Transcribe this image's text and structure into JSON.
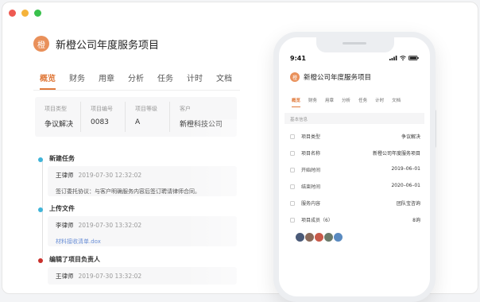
{
  "window": {
    "dots": [
      "#ee5a52",
      "#f5b33b",
      "#39c14c"
    ]
  },
  "project": {
    "avatar_char": "橙",
    "avatar_color": "#e9905a",
    "title": "新橙公司年度服务项目"
  },
  "accent": "#e07a3c",
  "tabs": [
    {
      "label": "概览",
      "active": true
    },
    {
      "label": "财务",
      "active": false
    },
    {
      "label": "用章",
      "active": false
    },
    {
      "label": "分析",
      "active": false
    },
    {
      "label": "任务",
      "active": false
    },
    {
      "label": "计时",
      "active": false
    },
    {
      "label": "文档",
      "active": false
    }
  ],
  "info": [
    {
      "label": "项目类型",
      "value": "争议解决"
    },
    {
      "label": "项目编号",
      "value": "0083"
    },
    {
      "label": "项目等级",
      "value": "A"
    },
    {
      "label": "客户",
      "value": "新橙科技公司"
    }
  ],
  "timeline": [
    {
      "title": "新建任务",
      "color": "#3fb4d8",
      "user": "王律师",
      "time": "2019-07-30 12:32:02",
      "body": "签订委托协议：与客户明确服务内容后签订聘请律师合同。",
      "is_link": false
    },
    {
      "title": "上传文件",
      "color": "#3fb4d8",
      "user": "李律师",
      "time": "2019-07-30 13:32:02",
      "body": "材料接收清单.dox",
      "is_link": true
    },
    {
      "title": "编辑了项目负责人",
      "color": "#c9302c",
      "user": "王律师",
      "time": "2019-07-30 13:32:02",
      "body": "",
      "is_link": false
    }
  ],
  "phone": {
    "time": "9:41",
    "title": "新橙公司年度服务项目",
    "tabs": [
      "概览",
      "财务",
      "用章",
      "分析",
      "任务",
      "计时",
      "文档"
    ],
    "section": "基本信息",
    "rows": [
      {
        "label": "项目类型",
        "value": "争议解决"
      },
      {
        "label": "项目名称",
        "value": "新橙公司年度服务项目"
      },
      {
        "label": "开始时间",
        "value": "2019–06–01"
      },
      {
        "label": "结束时间",
        "value": "2020–06–01"
      },
      {
        "label": "服务内容",
        "value": "团队宝咨询"
      },
      {
        "label": "项目成员（6）",
        "value": "8询"
      }
    ],
    "member_colors": [
      "#4a5a78",
      "#8a6a5a",
      "#c85a4a",
      "#6a7a6a",
      "#5a8ac0"
    ]
  }
}
